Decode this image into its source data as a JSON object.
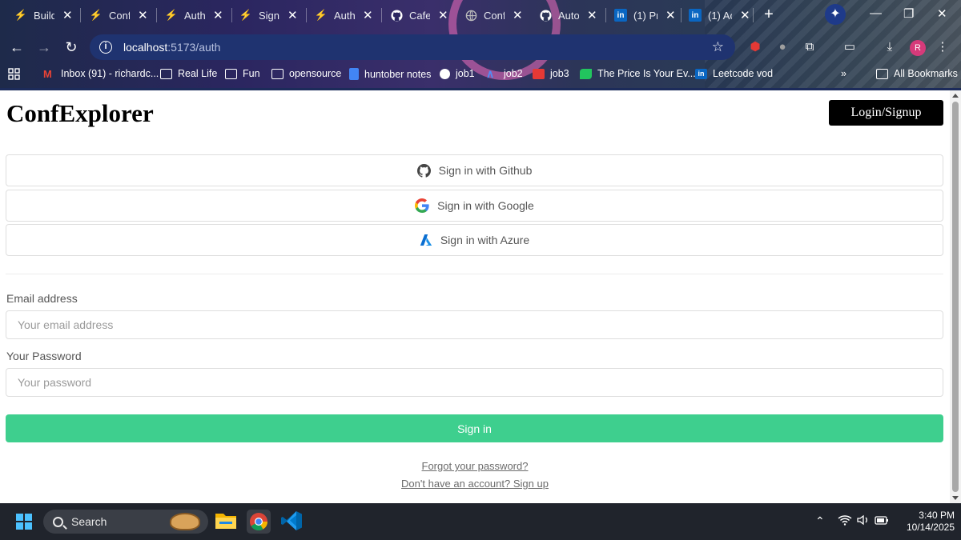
{
  "browser": {
    "tabs": [
      {
        "title": "Build",
        "icon": "bolt-icon"
      },
      {
        "title": "Confi",
        "icon": "bolt-icon"
      },
      {
        "title": "Authe",
        "icon": "bolt-icon"
      },
      {
        "title": "Signi",
        "icon": "bolt-icon"
      },
      {
        "title": "Authe",
        "icon": "bolt-icon"
      },
      {
        "title": "CafeL",
        "icon": "github-icon"
      },
      {
        "title": "Confi",
        "icon": "globe-icon"
      },
      {
        "title": "Auto",
        "icon": "github-icon"
      },
      {
        "title": "(1) Pr",
        "icon": "linkedin-icon"
      },
      {
        "title": "(1) Ac",
        "icon": "linkedin-icon"
      }
    ],
    "url_host": "localhost",
    "url_path": ":5173/auth",
    "profile_initial": "R",
    "bookmarks": [
      {
        "label": "Inbox (91) - richardc...",
        "icon": "gmail-icon"
      },
      {
        "label": "Real Life",
        "icon": "folder-icon"
      },
      {
        "label": "Fun",
        "icon": "folder-icon"
      },
      {
        "label": "opensource",
        "icon": "folder-icon"
      },
      {
        "label": "huntober notes",
        "icon": "docs-icon"
      },
      {
        "label": "job1",
        "icon": "job1-icon"
      },
      {
        "label": "job2",
        "icon": "job2-icon"
      },
      {
        "label": "job3",
        "icon": "job3-icon"
      },
      {
        "label": "The Price Is Your Ev...",
        "icon": "leaf-icon"
      },
      {
        "label": "Leetcode vod",
        "icon": "linkedin-icon"
      }
    ],
    "more_bookmarks": "»",
    "all_bookmarks": "All Bookmarks"
  },
  "app": {
    "brand": "ConfExplorer",
    "login_button": "Login/Signup",
    "oauth": {
      "github": "Sign in with Github",
      "google": "Sign in with Google",
      "azure": "Sign in with Azure"
    },
    "email": {
      "label": "Email address",
      "placeholder": "Your email address"
    },
    "password": {
      "label": "Your Password",
      "placeholder": "Your password"
    },
    "submit": "Sign in",
    "forgot_link": "Forgot your password?",
    "signup_link": "Don't have an account? Sign up",
    "colors": {
      "accent": "#3ecf8e",
      "primary_button": "#000000"
    }
  },
  "taskbar": {
    "search_label": "Search",
    "time": "3:40 PM",
    "date": "10/14/2025"
  }
}
